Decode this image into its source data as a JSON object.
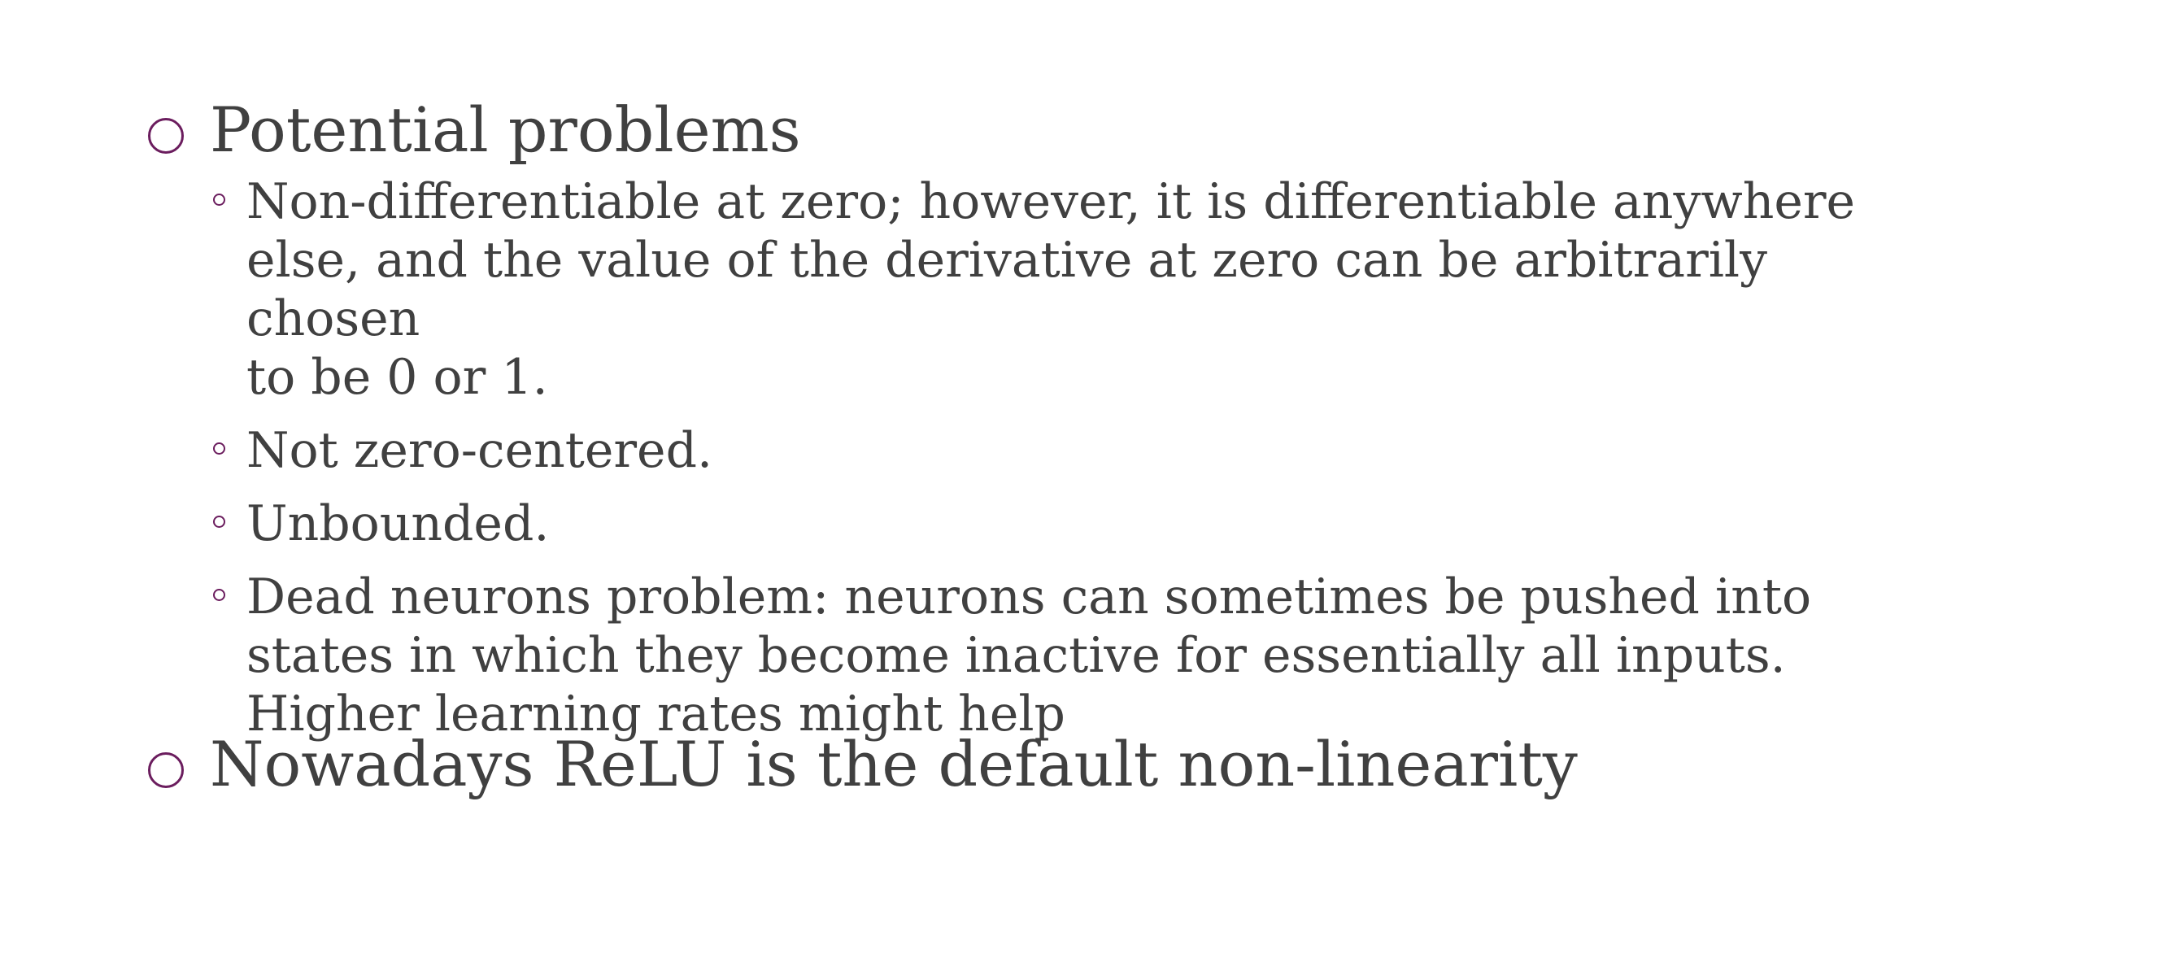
{
  "slide": {
    "bullets": [
      {
        "text": "Potential problems",
        "sub_bullets": [
          {
            "lines": [
              "Non-differentiable at zero; however, it is differentiable anywhere",
              "else, and the value of the derivative at zero can be arbitrarily chosen",
              "to be 0 or 1."
            ]
          },
          {
            "lines": [
              "Not zero-centered."
            ]
          },
          {
            "lines": [
              "Unbounded."
            ]
          },
          {
            "lines": [
              "Dead neurons problem: neurons can sometimes be pushed into",
              "states in which they become inactive for essentially all inputs.",
              "Higher learning rates might help"
            ]
          }
        ]
      },
      {
        "text": "Nowadays ReLU is the default non-linearity"
      }
    ],
    "colors": {
      "text": "#404040",
      "bullet": "#6b1d5e",
      "background": "#ffffff"
    },
    "icons": {
      "level1_bullet": "hollow-circle-icon",
      "level2_bullet": "small-hollow-circle-icon"
    }
  }
}
